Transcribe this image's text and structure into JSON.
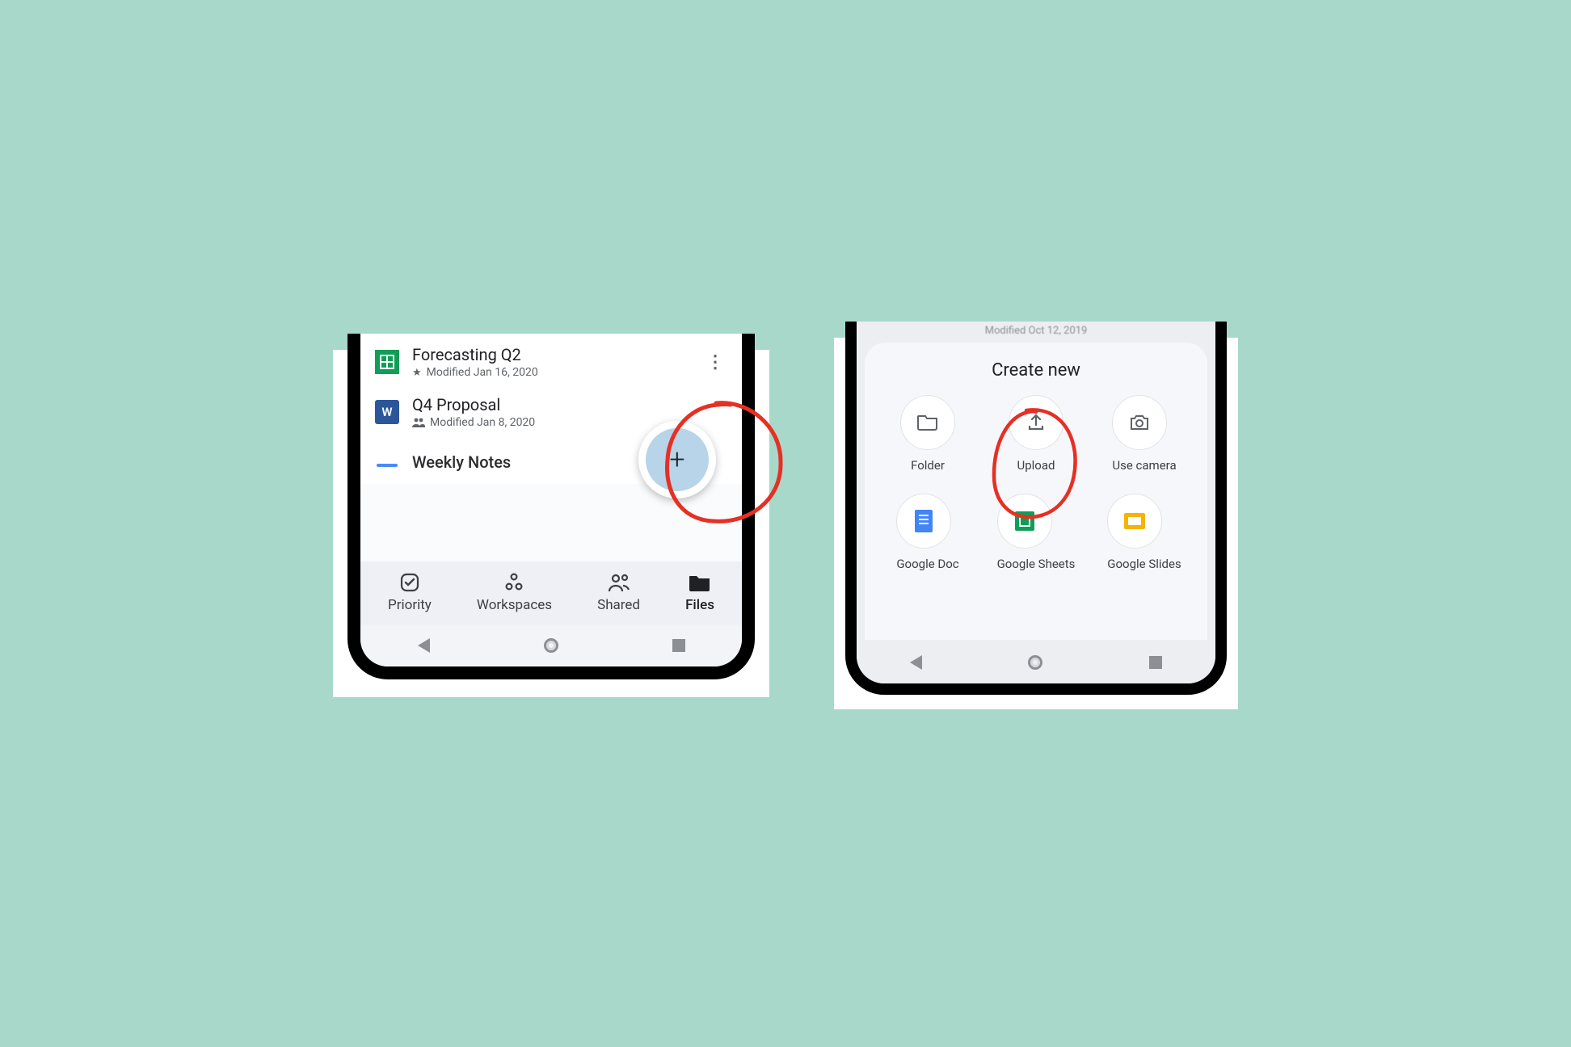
{
  "left": {
    "files": [
      {
        "title": "Forecasting Q2",
        "modified": "Modified Jan 16, 2020",
        "starred": true,
        "type": "sheet"
      },
      {
        "title": "Q4 Proposal",
        "modified": "Modified Jan 8, 2020",
        "shared": true,
        "type": "word"
      },
      {
        "title": "Weekly Notes",
        "modified": "",
        "type": "doc"
      }
    ],
    "fab_glyph": "+",
    "nav": [
      {
        "label": "Priority"
      },
      {
        "label": "Workspaces"
      },
      {
        "label": "Shared"
      },
      {
        "label": "Files",
        "active": true
      }
    ]
  },
  "right": {
    "behind": "Modified Oct 12, 2019",
    "sheet_title": "Create new",
    "options": [
      {
        "label": "Folder"
      },
      {
        "label": "Upload"
      },
      {
        "label": "Use camera"
      },
      {
        "label": "Google Doc"
      },
      {
        "label": "Google Sheets"
      },
      {
        "label": "Google Slides"
      }
    ]
  }
}
